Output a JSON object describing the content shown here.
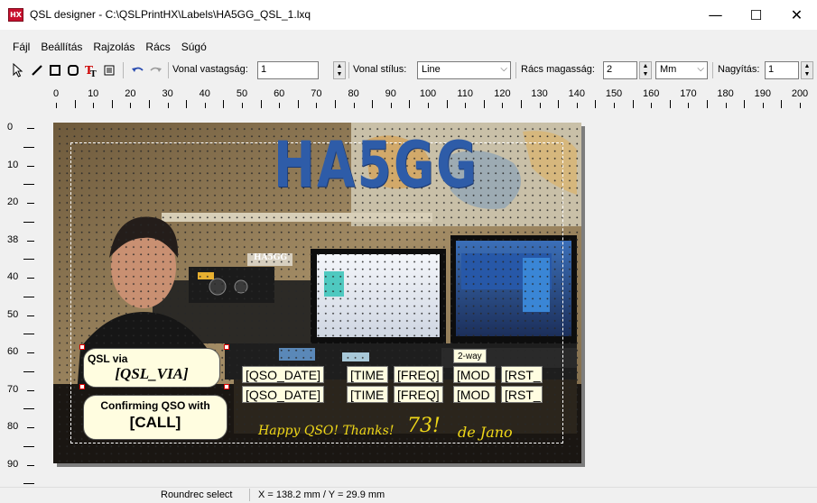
{
  "window": {
    "app_icon_text": "HX",
    "title": "QSL designer - C:\\QSLPrintHX\\Labels\\HA5GG_QSL_1.lxq",
    "minimize": "—",
    "maximize": "☐",
    "close": "✕"
  },
  "menu": [
    "Fájl",
    "Beállítás",
    "Rajzolás",
    "Rács",
    "Súgó"
  ],
  "toolbar": {
    "line_width_label": "Vonal vastagság:",
    "line_width_value": "1",
    "line_style_label": "Vonal stílus:",
    "line_style_value": "Line",
    "grid_height_label": "Rács magasság:",
    "grid_height_value": "2",
    "unit_value": "Mm",
    "zoom_label": "Nagyítás:",
    "zoom_value": "1"
  },
  "ruler": {
    "h_labels": [
      "0",
      "10",
      "20",
      "30",
      "40",
      "50",
      "60",
      "70",
      "80",
      "90",
      "100",
      "110",
      "120",
      "130",
      "140",
      "150",
      "160",
      "170",
      "180",
      "190",
      "200"
    ],
    "v_labels": [
      "0",
      "10",
      "20",
      "38",
      "40",
      "50",
      "60",
      "70",
      "80",
      "90"
    ]
  },
  "card": {
    "callsign": "HA5GG",
    "station_label": "HA5GG",
    "qsl_via_label": "QSL via",
    "qsl_via_value": "[QSL_VIA]",
    "confirm_label": "Confirming QSO with",
    "confirm_value": "[CALL]",
    "two_way": "2-way",
    "fields_row1": [
      "[QSO_DATE]",
      "[TIME",
      "[FREQ]",
      "[MOD",
      "[RST_"
    ],
    "fields_row2": [
      "[QSO_DATE]",
      "[TIME",
      "[FREQ]",
      "[MOD",
      "[RST_"
    ],
    "greeting": "Happy QSO! Thanks!",
    "seventy_three": "73!",
    "signature": "de Jano"
  },
  "status": {
    "mode": "Roundrec select",
    "coords": "X = 138.2 mm / Y = 29.9 mm"
  }
}
